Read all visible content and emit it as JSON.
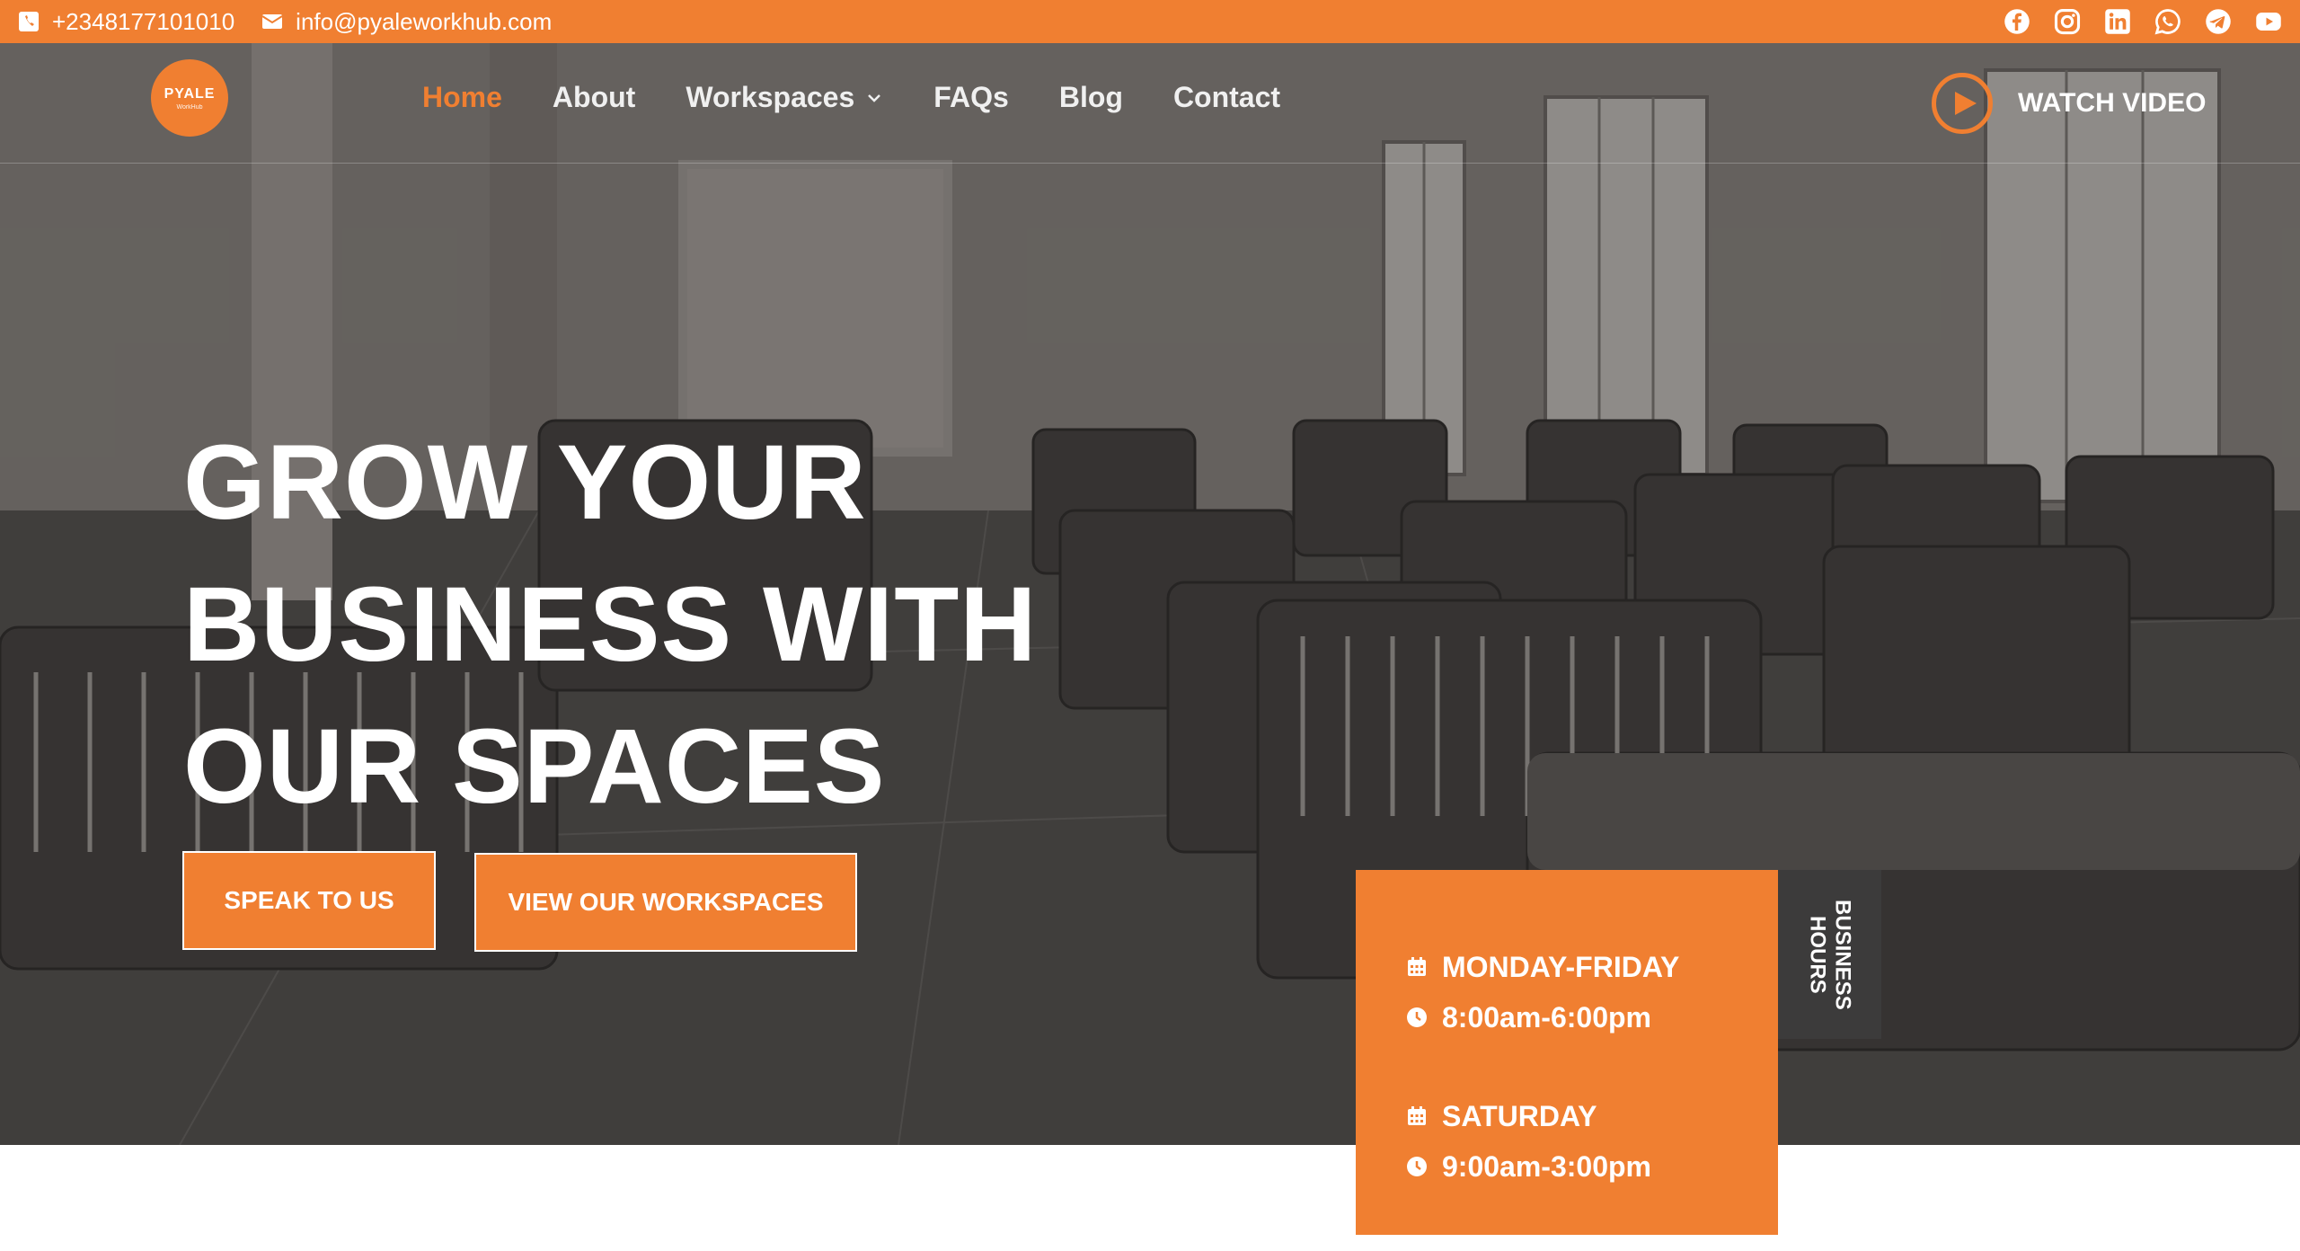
{
  "topbar": {
    "phone": "+2348177101010",
    "email": "info@pyaleworkhub.com",
    "socials": [
      "facebook-icon",
      "instagram-icon",
      "linkedin-icon",
      "whatsapp-icon",
      "telegram-icon",
      "youtube-icon"
    ]
  },
  "logo": {
    "name": "PYALE",
    "sub": "WorkHub"
  },
  "nav": {
    "items": [
      "Home",
      "About",
      "Workspaces",
      "FAQs",
      "Blog",
      "Contact"
    ],
    "active": "Home",
    "watch_video": "WATCH VIDEO"
  },
  "hero": {
    "headline": [
      "GROW YOUR",
      "BUSINESS WITH",
      "OUR SPACES"
    ],
    "btn_speak": "SPEAK TO US",
    "btn_view": "VIEW OUR WORKSPACES"
  },
  "hours": {
    "tab_label": "BUSINESS HOURS",
    "weekdays_label": "MONDAY-FRIDAY",
    "weekdays_time": "8:00am-6:00pm",
    "saturday_label": "SATURDAY",
    "saturday_time": "9:00am-3:00pm"
  },
  "colors": {
    "accent": "#f07f31",
    "dark_tab": "#3c3b3b"
  }
}
